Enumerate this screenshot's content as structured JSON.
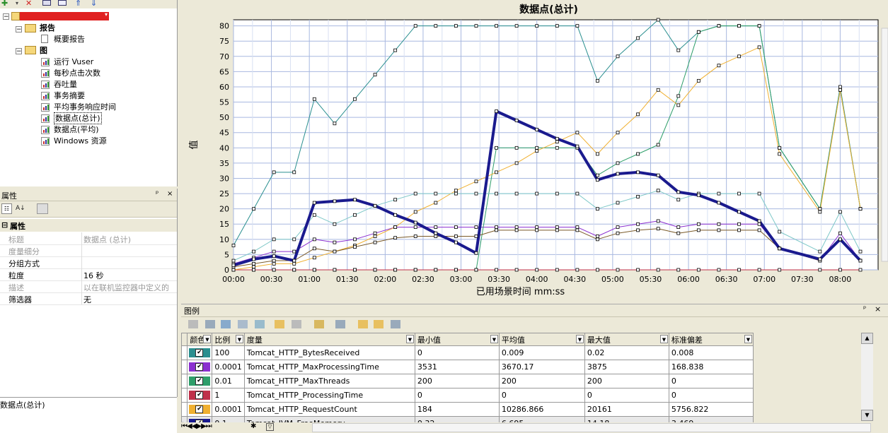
{
  "tree": {
    "root_label": "",
    "reports_label": "报告",
    "summary_report_label": "概要报告",
    "graphs_label": "图",
    "graph_items": [
      "运行 Vuser",
      "每秒点击次数",
      "吞吐量",
      "事务摘要",
      "平均事务响应时间",
      "数据点(总计)",
      "数据点(平均)",
      "Windows 资源"
    ],
    "selected_index": 5
  },
  "properties": {
    "title": "属性",
    "pin": "ᵖ",
    "close": "×",
    "section": "属性",
    "rows": [
      {
        "key": "标题",
        "value": "数据点 (总计)",
        "disabled": true
      },
      {
        "key": "度量细分",
        "value": "",
        "disabled": true
      },
      {
        "key": "分组方式",
        "value": "",
        "disabled": false
      },
      {
        "key": "粒度",
        "value": "16 秒",
        "disabled": false
      },
      {
        "key": "描述",
        "value": "以在联机监控器中定义的",
        "disabled": true
      },
      {
        "key": "筛选器",
        "value": "无",
        "disabled": false
      }
    ],
    "description": "数据点(总计)"
  },
  "chart_data": {
    "type": "line",
    "title": "数据点(总计)",
    "xlabel": "已用场景时间 mm:ss",
    "ylabel": "值",
    "ylim": [
      0,
      82
    ],
    "yticks": [
      0,
      5,
      10,
      15,
      20,
      25,
      30,
      35,
      40,
      45,
      50,
      55,
      60,
      65,
      70,
      75,
      80
    ],
    "x_tick_labels": [
      "00:00",
      "00:30",
      "01:00",
      "01:30",
      "02:00",
      "02:30",
      "03:00",
      "03:30",
      "04:00",
      "04:30",
      "05:00",
      "05:30",
      "06:00",
      "06:30",
      "07:00",
      "07:30",
      "08:00"
    ],
    "x_tick_seconds": [
      0,
      30,
      60,
      90,
      120,
      150,
      180,
      210,
      240,
      270,
      300,
      330,
      360,
      390,
      420,
      450,
      480
    ],
    "xlim_seconds": [
      0,
      510
    ],
    "grid": true,
    "series": [
      {
        "name": "Tomcat_HTTP_BytesReceived",
        "color": "#2a8f8f",
        "width": 1,
        "points": [
          [
            0,
            8
          ],
          [
            16,
            20
          ],
          [
            32,
            32
          ],
          [
            48,
            32
          ],
          [
            64,
            56
          ],
          [
            80,
            48
          ],
          [
            96,
            56
          ],
          [
            112,
            64
          ],
          [
            128,
            72
          ],
          [
            144,
            80
          ],
          [
            160,
            80
          ],
          [
            176,
            80
          ],
          [
            192,
            80
          ],
          [
            208,
            80
          ],
          [
            224,
            80
          ],
          [
            240,
            80
          ],
          [
            256,
            80
          ],
          [
            272,
            80
          ],
          [
            288,
            62
          ],
          [
            304,
            70
          ],
          [
            320,
            76
          ],
          [
            336,
            82
          ],
          [
            352,
            72
          ],
          [
            368,
            78
          ],
          [
            384,
            80
          ],
          [
            400,
            80
          ],
          [
            416,
            80
          ],
          [
            432,
            40
          ],
          [
            464,
            20
          ],
          [
            480,
            60
          ],
          [
            496,
            20
          ]
        ]
      },
      {
        "name": "Tomcat_HTTP_MaxProcessingTime",
        "color": "#8b2fd0",
        "width": 1,
        "points": [
          [
            0,
            2
          ],
          [
            16,
            4
          ],
          [
            32,
            6
          ],
          [
            48,
            6
          ],
          [
            64,
            10
          ],
          [
            80,
            9
          ],
          [
            96,
            10
          ],
          [
            112,
            12
          ],
          [
            128,
            14
          ],
          [
            144,
            14
          ],
          [
            160,
            14
          ],
          [
            176,
            14
          ],
          [
            192,
            14
          ],
          [
            208,
            14
          ],
          [
            224,
            14
          ],
          [
            240,
            14
          ],
          [
            256,
            14
          ],
          [
            272,
            14
          ],
          [
            288,
            11
          ],
          [
            304,
            14
          ],
          [
            320,
            15
          ],
          [
            336,
            16
          ],
          [
            352,
            14
          ],
          [
            368,
            15
          ],
          [
            384,
            15
          ],
          [
            400,
            15
          ],
          [
            416,
            15
          ],
          [
            432,
            7
          ],
          [
            464,
            3
          ],
          [
            480,
            12
          ],
          [
            496,
            3
          ]
        ]
      },
      {
        "name": "Tomcat_HTTP_MaxThreads",
        "color": "#2e9e6a",
        "width": 1,
        "points": [
          [
            0,
            0
          ],
          [
            16,
            0
          ],
          [
            32,
            0
          ],
          [
            48,
            0
          ],
          [
            64,
            0
          ],
          [
            80,
            0
          ],
          [
            96,
            0
          ],
          [
            112,
            0
          ],
          [
            128,
            0
          ],
          [
            144,
            0
          ],
          [
            160,
            0
          ],
          [
            176,
            0
          ],
          [
            192,
            0
          ],
          [
            208,
            40
          ],
          [
            224,
            40
          ],
          [
            240,
            40
          ],
          [
            256,
            40
          ],
          [
            272,
            40
          ],
          [
            288,
            31
          ],
          [
            304,
            35
          ],
          [
            320,
            38
          ],
          [
            336,
            41
          ],
          [
            352,
            57
          ],
          [
            368,
            78
          ],
          [
            384,
            80
          ],
          [
            400,
            80
          ],
          [
            416,
            80
          ],
          [
            432,
            40
          ],
          [
            464,
            20
          ],
          [
            480,
            59
          ],
          [
            496,
            20
          ]
        ]
      },
      {
        "name": "Tomcat_HTTP_ProcessingTime",
        "color": "#c0304a",
        "width": 1,
        "points": [
          [
            0,
            0
          ],
          [
            16,
            0
          ],
          [
            32,
            0
          ],
          [
            48,
            0
          ],
          [
            64,
            0
          ],
          [
            80,
            0
          ],
          [
            96,
            0
          ],
          [
            112,
            0
          ],
          [
            128,
            0
          ],
          [
            144,
            0
          ],
          [
            160,
            0
          ],
          [
            176,
            0
          ],
          [
            192,
            0
          ],
          [
            208,
            0
          ],
          [
            224,
            0
          ],
          [
            240,
            0
          ],
          [
            256,
            0
          ],
          [
            272,
            0
          ],
          [
            288,
            0
          ],
          [
            304,
            0
          ],
          [
            320,
            0
          ],
          [
            336,
            0
          ],
          [
            352,
            0
          ],
          [
            368,
            0
          ],
          [
            384,
            0
          ],
          [
            400,
            0
          ],
          [
            416,
            0
          ],
          [
            432,
            0
          ],
          [
            464,
            0
          ],
          [
            480,
            0
          ],
          [
            496,
            0
          ]
        ]
      },
      {
        "name": "Tomcat_HTTP_RequestCount",
        "color": "#f0b030",
        "width": 1,
        "points": [
          [
            0,
            0
          ],
          [
            16,
            1
          ],
          [
            32,
            2
          ],
          [
            48,
            2
          ],
          [
            64,
            4
          ],
          [
            80,
            6
          ],
          [
            96,
            8
          ],
          [
            112,
            11
          ],
          [
            128,
            14
          ],
          [
            144,
            19
          ],
          [
            160,
            22
          ],
          [
            176,
            26
          ],
          [
            192,
            29
          ],
          [
            208,
            32
          ],
          [
            224,
            35
          ],
          [
            240,
            39
          ],
          [
            256,
            42
          ],
          [
            272,
            45
          ],
          [
            288,
            38
          ],
          [
            304,
            45
          ],
          [
            320,
            51
          ],
          [
            336,
            59
          ],
          [
            352,
            54
          ],
          [
            368,
            62
          ],
          [
            384,
            67
          ],
          [
            400,
            70
          ],
          [
            416,
            73
          ],
          [
            432,
            38
          ],
          [
            464,
            19
          ],
          [
            480,
            59
          ],
          [
            496,
            20
          ]
        ]
      },
      {
        "name": "Tomcat_JVM_FreeMemory",
        "color": "#1a1a8e",
        "width": 4,
        "points": [
          [
            0,
            1.5
          ],
          [
            16,
            3.5
          ],
          [
            32,
            4.5
          ],
          [
            48,
            3
          ],
          [
            64,
            22
          ],
          [
            80,
            22.5
          ],
          [
            96,
            23
          ],
          [
            112,
            21
          ],
          [
            128,
            18
          ],
          [
            144,
            15.5
          ],
          [
            160,
            12
          ],
          [
            176,
            9
          ],
          [
            192,
            5.5
          ],
          [
            208,
            52
          ],
          [
            224,
            49
          ],
          [
            240,
            46
          ],
          [
            256,
            43
          ],
          [
            272,
            40.5
          ],
          [
            288,
            29.5
          ],
          [
            304,
            31.5
          ],
          [
            320,
            32
          ],
          [
            336,
            31
          ],
          [
            352,
            25.5
          ],
          [
            368,
            24.5
          ],
          [
            384,
            22
          ],
          [
            400,
            19
          ],
          [
            416,
            16
          ],
          [
            432,
            7
          ],
          [
            464,
            3.5
          ],
          [
            480,
            10
          ],
          [
            496,
            3
          ]
        ]
      },
      {
        "name": "",
        "color": "#7fc8c8",
        "width": 1,
        "points": [
          [
            0,
            3
          ],
          [
            16,
            6
          ],
          [
            32,
            10
          ],
          [
            48,
            10
          ],
          [
            64,
            18
          ],
          [
            80,
            15
          ],
          [
            96,
            18
          ],
          [
            112,
            21
          ],
          [
            128,
            23
          ],
          [
            144,
            25
          ],
          [
            160,
            25
          ],
          [
            176,
            25
          ],
          [
            192,
            25
          ],
          [
            208,
            25
          ],
          [
            224,
            25
          ],
          [
            240,
            25
          ],
          [
            256,
            25
          ],
          [
            272,
            25
          ],
          [
            288,
            20
          ],
          [
            304,
            22
          ],
          [
            320,
            24
          ],
          [
            336,
            26
          ],
          [
            352,
            23
          ],
          [
            368,
            25
          ],
          [
            384,
            25
          ],
          [
            400,
            25
          ],
          [
            416,
            25
          ],
          [
            432,
            12.5
          ],
          [
            464,
            6
          ],
          [
            480,
            19
          ],
          [
            496,
            6
          ]
        ]
      },
      {
        "name": "",
        "color": "#7a5a28",
        "width": 1,
        "points": [
          [
            0,
            1
          ],
          [
            16,
            2
          ],
          [
            32,
            3
          ],
          [
            48,
            3
          ],
          [
            64,
            7
          ],
          [
            80,
            6
          ],
          [
            96,
            7.5
          ],
          [
            112,
            9
          ],
          [
            128,
            10.5
          ],
          [
            144,
            11
          ],
          [
            160,
            11
          ],
          [
            176,
            11
          ],
          [
            192,
            11
          ],
          [
            208,
            13
          ],
          [
            224,
            13
          ],
          [
            240,
            13
          ],
          [
            256,
            13
          ],
          [
            272,
            13
          ],
          [
            288,
            10
          ],
          [
            304,
            12
          ],
          [
            320,
            13
          ],
          [
            336,
            13.5
          ],
          [
            352,
            12
          ],
          [
            368,
            13
          ],
          [
            384,
            13
          ],
          [
            400,
            13
          ],
          [
            416,
            13
          ],
          [
            432,
            7
          ],
          [
            464,
            3
          ],
          [
            480,
            10
          ],
          [
            496,
            3
          ]
        ]
      }
    ]
  },
  "legend": {
    "title": "图例",
    "columns": [
      "颜色",
      "比例",
      "度量",
      "最小值",
      "平均值",
      "最大值",
      "标准偏差"
    ],
    "rows": [
      {
        "color": "#2a8f8f",
        "scale": "100",
        "measure": "Tomcat_HTTP_BytesReceived",
        "min": "0",
        "avg": "0.009",
        "max": "0.02",
        "std": "0.008"
      },
      {
        "color": "#8b2fd0",
        "scale": "0.0001",
        "measure": "Tomcat_HTTP_MaxProcessingTime",
        "min": "3531",
        "avg": "3670.17",
        "max": "3875",
        "std": "168.838"
      },
      {
        "color": "#2e9e6a",
        "scale": "0.01",
        "measure": "Tomcat_HTTP_MaxThreads",
        "min": "200",
        "avg": "200",
        "max": "200",
        "std": "0"
      },
      {
        "color": "#c0304a",
        "scale": "1",
        "measure": "Tomcat_HTTP_ProcessingTime",
        "min": "0",
        "avg": "0",
        "max": "0",
        "std": "0"
      },
      {
        "color": "#f0b030",
        "scale": "0.0001",
        "measure": "Tomcat_HTTP_RequestCount",
        "min": "184",
        "avg": "10286.866",
        "max": "20161",
        "std": "5756.822"
      },
      {
        "color": "#1a1a8e",
        "scale": "0.1",
        "measure": "Tomcat_JVM_FreeMemory",
        "min": "0.32",
        "avg": "6.695",
        "max": "14.18",
        "std": "3.469"
      }
    ],
    "pin": "ᵖ",
    "close": "×",
    "nav_glyphs": "⏮◀◀▶▶⏭"
  }
}
